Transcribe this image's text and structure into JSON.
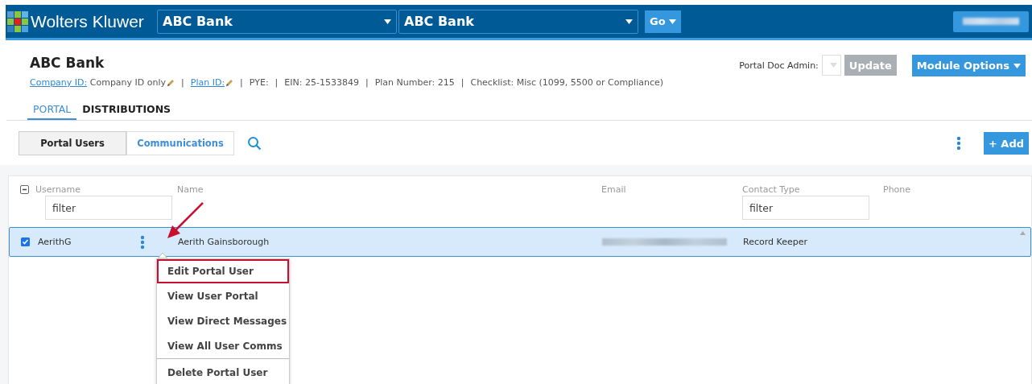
{
  "header": {
    "brand": "Wolters Kluwer",
    "company_select": {
      "value": "ABC Bank"
    },
    "plan_select": {
      "value": "ABC Bank"
    },
    "go_button": "Go",
    "user_menu": {
      "kind": "redacted"
    }
  },
  "plan": {
    "title": "ABC Bank",
    "info": [
      {
        "kind": "link",
        "label": "Company ID:",
        "value": "Company ID only",
        "editable": true
      },
      {
        "kind": "link",
        "label": "Plan ID:",
        "editable": true,
        "separator": "|"
      },
      {
        "kind": "text",
        "label": "PYE:",
        "editable": false,
        "separator": "|"
      },
      {
        "kind": "text",
        "label": "EIN: 25-1533849",
        "editable": false,
        "separator": "|"
      },
      {
        "kind": "text",
        "label": "Plan Number: 215",
        "editable": false,
        "separator": "|"
      },
      {
        "kind": "text",
        "label": "Checklist: Misc (1099, 5500 or Compliance)",
        "editable": false,
        "separator": "|"
      }
    ],
    "doc_admin_label": "Portal Doc Admin:",
    "update_button": {
      "label": "Update",
      "disabled": true
    },
    "module_options": "Module Options"
  },
  "tabs": [
    {
      "label": "PORTAL",
      "selected": true
    },
    {
      "label": "DISTRIBUTIONS",
      "selected": false
    }
  ],
  "segments": [
    {
      "label": "Portal Users",
      "selected": true
    },
    {
      "label": "Communications",
      "selected": false
    }
  ],
  "add_button": "+ Add",
  "table": {
    "select_all": {
      "indeterminate": true
    },
    "columns": [
      {
        "label": "Username",
        "filter": "filter"
      },
      {
        "label": "Name"
      },
      {
        "label": "Email"
      },
      {
        "label": "Contact Type",
        "filter": "filter"
      },
      {
        "label": "Phone"
      }
    ],
    "rows": [
      {
        "checked": true,
        "selected": true,
        "username": "AerithG",
        "name": "Aerith Gainsborough",
        "contact_type": "Record Keeper"
      }
    ]
  },
  "row_menu": {
    "items": [
      {
        "label": "Edit Portal User",
        "highlighted": true,
        "divider_above": false
      },
      {
        "label": "View User Portal",
        "highlighted": false,
        "divider_above": false
      },
      {
        "label": "View Direct Messages",
        "highlighted": false,
        "divider_above": false
      },
      {
        "label": "View All User Comms",
        "highlighted": false,
        "divider_above": false
      },
      {
        "label": "Delete Portal User",
        "highlighted": false,
        "divider_above": true
      }
    ]
  }
}
